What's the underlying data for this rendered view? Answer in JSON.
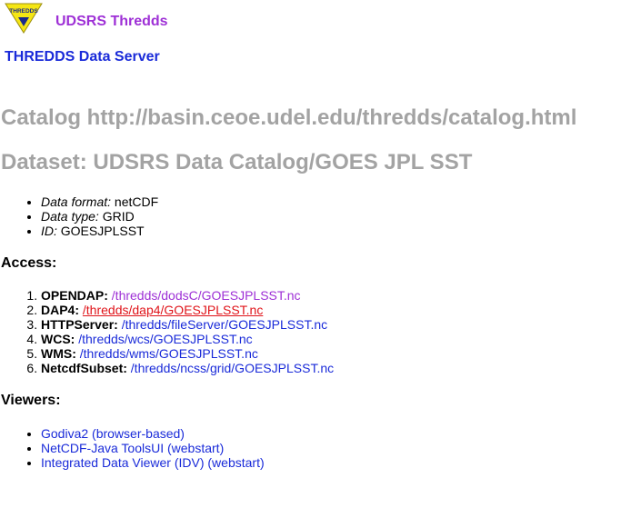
{
  "header": {
    "site_name": "UDSRS Thredds",
    "logo_text": "THREDDS",
    "server_name": "THREDDS Data Server"
  },
  "catalog_heading": "Catalog http://basin.ceoe.udel.edu/thredds/catalog.html",
  "dataset_heading": "Dataset: UDSRS Data Catalog/GOES JPL SST",
  "properties": [
    {
      "label": "Data format:",
      "value": "netCDF"
    },
    {
      "label": "Data type:",
      "value": "GRID"
    },
    {
      "label": "ID:",
      "value": "GOESJPLSST"
    }
  ],
  "access": {
    "heading": "Access:",
    "services": [
      {
        "name": "OPENDAP:",
        "path": "/thredds/dodsC/GOESJPLSST.nc"
      },
      {
        "name": "DAP4:",
        "path": "/thredds/dap4/GOESJPLSST.nc"
      },
      {
        "name": "HTTPServer:",
        "path": "/thredds/fileServer/GOESJPLSST.nc"
      },
      {
        "name": "WCS:",
        "path": "/thredds/wcs/GOESJPLSST.nc"
      },
      {
        "name": "WMS:",
        "path": "/thredds/wms/GOESJPLSST.nc"
      },
      {
        "name": "NetcdfSubset:",
        "path": "/thredds/ncss/grid/GOESJPLSST.nc"
      }
    ]
  },
  "viewers": {
    "heading": "Viewers:",
    "items": [
      "Godiva2 (browser-based)",
      "NetCDF-Java ToolsUI (webstart)",
      "Integrated Data Viewer (IDV) (webstart)"
    ]
  },
  "colors": {
    "link": "#1a2bd9",
    "visited_link": "#9e30d6",
    "active_link": "#e0141a",
    "heading_gray": "#a3a3a3"
  }
}
